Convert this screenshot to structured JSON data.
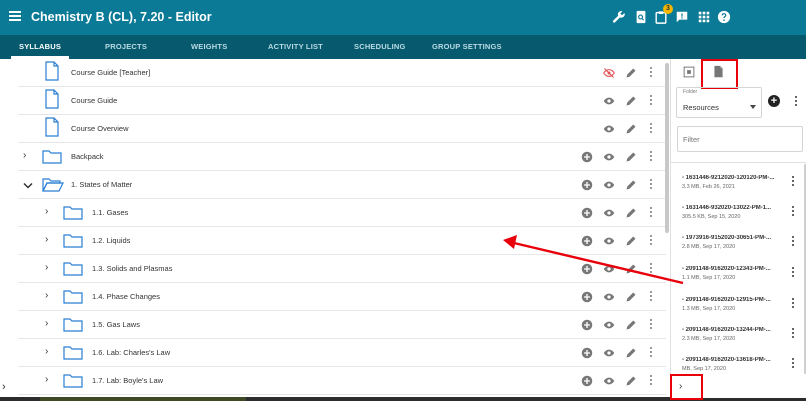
{
  "header": {
    "title": "Chemistry B (CL), 7.20 - Editor",
    "notification_count": "3",
    "icons": [
      "menu-icon",
      "wrench-icon",
      "search-doc-icon",
      "clipboard-icon",
      "feedback-icon",
      "apps-grid-icon",
      "help-icon"
    ]
  },
  "tabs": [
    "SYLLABUS",
    "PROJECTS",
    "WEIGHTS",
    "ACTIVITY LIST",
    "SCHEDULING",
    "GROUP SETTINGS"
  ],
  "active_tab": "SYLLABUS",
  "syllabus": {
    "rows": [
      {
        "label": "Course Guide [Teacher]",
        "type": "document",
        "hidden": true
      },
      {
        "label": "Course Guide",
        "type": "document",
        "hidden": false
      },
      {
        "label": "Course Overview",
        "type": "document",
        "hidden": false
      },
      {
        "label": "Backpack",
        "type": "folder",
        "expanded": false
      },
      {
        "label": "1. States of Matter",
        "type": "folder",
        "expanded": true
      },
      {
        "label": "1.1. Gases",
        "type": "folder",
        "expanded": false
      },
      {
        "label": "1.2. Liquids",
        "type": "folder",
        "expanded": false
      },
      {
        "label": "1.3. Solids and Plasmas",
        "type": "folder",
        "expanded": false
      },
      {
        "label": "1.4. Phase Changes",
        "type": "folder",
        "expanded": false
      },
      {
        "label": "1.5. Gas Laws",
        "type": "folder",
        "expanded": false
      },
      {
        "label": "1.6. Lab: Charles's Law",
        "type": "folder",
        "expanded": false
      },
      {
        "label": "1.7. Lab: Boyle's Law",
        "type": "folder",
        "expanded": false
      }
    ]
  },
  "resources_panel": {
    "folder_label": "Folder",
    "folder_value": "Resources",
    "filter_placeholder": "Filter",
    "files": [
      {
        "name": "- 1631446-9212020-120120-PM-...",
        "meta": "3.3 MB, Feb 26, 2021"
      },
      {
        "name": "- 1631446-932020-13022-PM-1...",
        "meta": "305.5 KB, Sep 15, 2020"
      },
      {
        "name": "- 1973916-9152020-30651-PM-...",
        "meta": "2.8 MB, Sep 17, 2020"
      },
      {
        "name": "- 2091148-9162020-12343-PM-...",
        "meta": "1.1 MB, Sep 17, 2020"
      },
      {
        "name": "- 2091148-9162020-12915-PM-...",
        "meta": "1.3 MB, Sep 17, 2020"
      },
      {
        "name": "- 2091148-9162020-13244-PM-...",
        "meta": "2.3 MB, Sep 17, 2020"
      },
      {
        "name": "- 2091148-9162020-13618-PM-...",
        "meta": "MB, Sep 17, 2020"
      }
    ]
  },
  "colors": {
    "header": "#0b7a96",
    "tabbar": "#075a6e",
    "annotation": "#e8000b",
    "hidden_eye": "#e05050"
  }
}
